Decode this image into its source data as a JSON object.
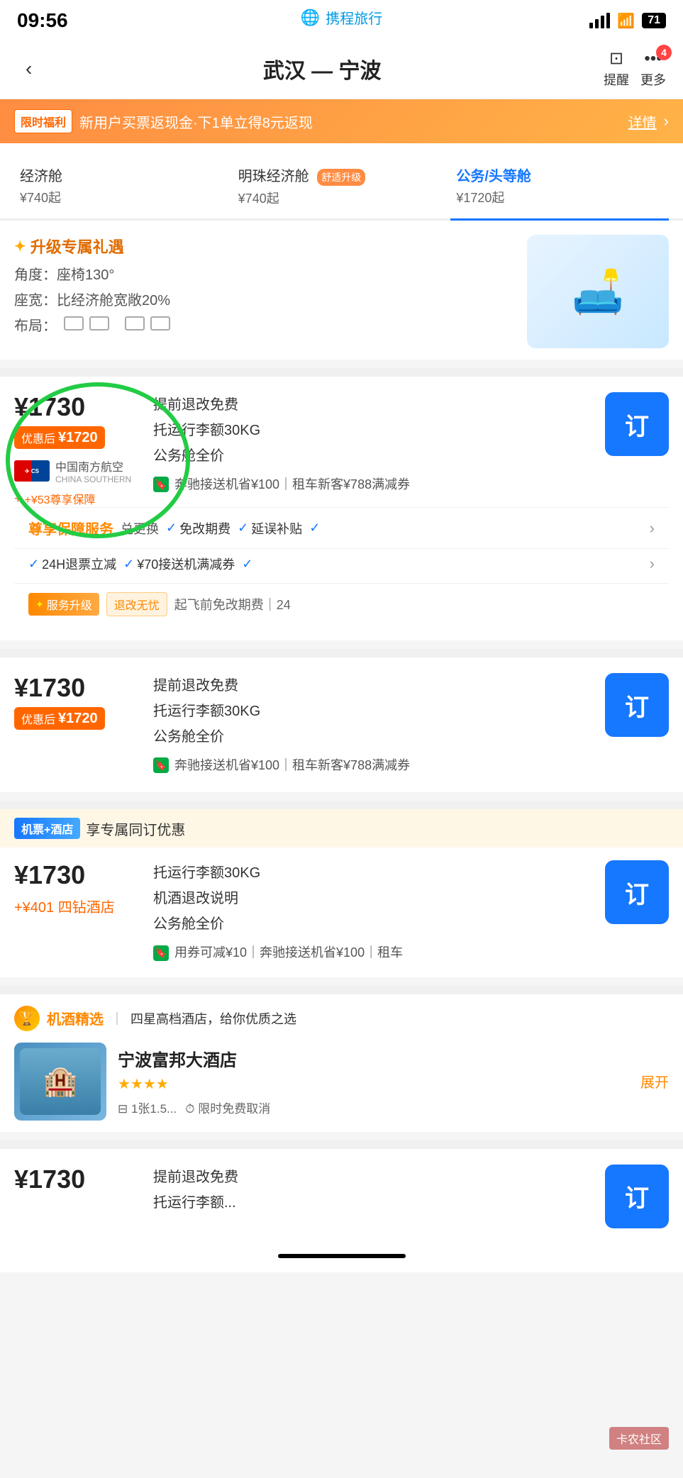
{
  "statusBar": {
    "time": "09:56",
    "battery": "71",
    "appName": "携程旅行"
  },
  "navBar": {
    "backLabel": "‹",
    "title": "武汉 — 宁波",
    "alertLabel": "提醒",
    "moreLabel": "更多",
    "badgeCount": "4"
  },
  "promoBanner": {
    "tag": "限时福利",
    "text": "新用户买票返现金·下1单立得8元返现",
    "detailLabel": "详情"
  },
  "cabinTabs": [
    {
      "name": "经济舱",
      "price": "¥740起",
      "active": false
    },
    {
      "name": "明珠经济舱",
      "price": "¥740起",
      "badge": "舒适升级",
      "active": false
    },
    {
      "name": "公务/头等舱",
      "price": "¥1720起",
      "active": true
    }
  ],
  "upgradeSection": {
    "title": "升级专属礼遇",
    "angle": "角度：座椅130°",
    "width": "座宽：比经济舱宽敞20%",
    "layout": "布局："
  },
  "ticket1": {
    "originalPrice": "¥1730",
    "discountLabel": "优惠后",
    "discountPrice": "¥1720",
    "airlineName": "中国南方航空",
    "airlineNameEn": "CHINA SOUTHERN",
    "guaranteeTag": "+¥53尊享保障",
    "feature1": "提前退改免费",
    "feature2": "托运行李额30KG",
    "feature3": "公务舱全价",
    "couponText": "奔驰接送机省¥100｜租车新客¥788满减券",
    "bookLabel": "订",
    "guaranteeService": "尊享保障服务",
    "exchangeLabel": "兑更换",
    "checkItems": [
      "免改期费",
      "延误补贴",
      "24H退票立减",
      "¥70接送机满减券"
    ],
    "serviceUpgrade": "服务升级",
    "refundFree": "退改无忧",
    "serviceDetail": "起飞前免改期费｜24"
  },
  "ticket2": {
    "originalPrice": "¥1730",
    "discountLabel": "优惠后",
    "discountPrice": "¥1720",
    "feature1": "提前退改免费",
    "feature2": "托运行李额30KG",
    "feature3": "公务舱全价",
    "couponText": "奔驰接送机省¥100｜租车新客¥788满减券",
    "bookLabel": "订"
  },
  "hotelBundle": {
    "tag": "机票+酒店",
    "desc": "享专属同订优惠",
    "originalPrice": "¥1730",
    "addon": "+¥401 四钻酒店",
    "feature1": "托运行李额30KG",
    "feature2": "机酒退改说明",
    "feature3": "公务舱全价",
    "couponText": "用券可减¥10｜奔驰接送机省¥100｜租车",
    "bookLabel": "订"
  },
  "featuredHotel": {
    "iconLabel": "🏆",
    "title": "机酒精选",
    "subtitle": "四星高档酒店，给你优质之选",
    "hotelName": "宁波富邦大酒店",
    "stars": "★★★★",
    "roomInfo": "⊟ 1张1.5...",
    "cancelInfo": "⏱ 限时免费取消",
    "expandLabel": "展开"
  },
  "bottomTicket": {
    "originalPrice": "¥1730",
    "feature1": "提前退改免费",
    "feature2": "托运行李额...",
    "bookLabel": "订"
  },
  "watermark": "卡农社区"
}
